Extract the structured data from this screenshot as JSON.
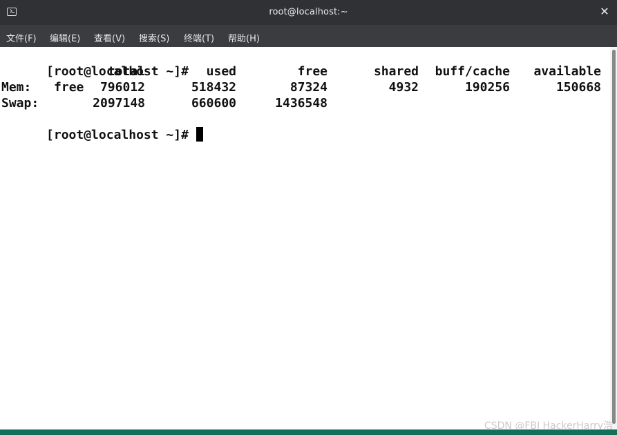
{
  "window": {
    "title": "root@localhost:~",
    "close_symbol": "✕"
  },
  "menu": {
    "items": [
      {
        "label": "文件(F)"
      },
      {
        "label": "编辑(E)"
      },
      {
        "label": "查看(V)"
      },
      {
        "label": "搜索(S)"
      },
      {
        "label": "终端(T)"
      },
      {
        "label": "帮助(H)"
      }
    ]
  },
  "terminal": {
    "prompt": "[root@localhost ~]#",
    "command": "free",
    "header": [
      "total",
      "used",
      "free",
      "shared",
      "buff/cache",
      "available"
    ],
    "rows": [
      {
        "label": "Mem:",
        "values": [
          "796012",
          "518432",
          "87324",
          "4932",
          "190256",
          "150668"
        ]
      },
      {
        "label": "Swap:",
        "values": [
          "2097148",
          "660600",
          "1436548",
          "",
          "",
          ""
        ]
      }
    ]
  },
  "watermark": "CSDN @FBI HackerHarry浩",
  "colors": {
    "titlebar": "#2f3134",
    "menubar": "#3a3c3f",
    "terminal_bg": "#ffffff",
    "terminal_fg": "#111111",
    "accent_strip": "#14705a"
  }
}
